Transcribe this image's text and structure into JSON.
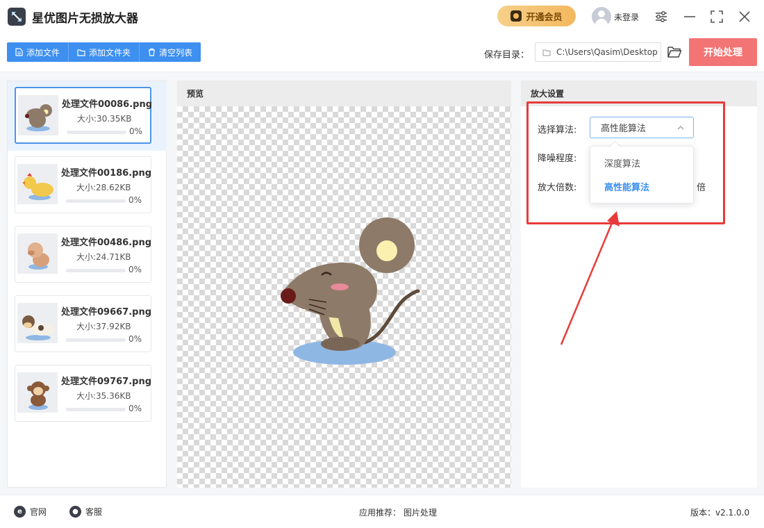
{
  "app": {
    "title": "星优图片无损放大器",
    "vip_label": "开通会员",
    "login_label": "未登录"
  },
  "toolbar": {
    "add_file": "添加文件",
    "add_folder": "添加文件夹",
    "clear_list": "清空列表",
    "save_dir_label": "保存目录：",
    "save_dir_value": "C:\\Users\\Qasim\\Desktop",
    "start_label": "开始处理"
  },
  "files": [
    {
      "name": "处理文件00086.png",
      "size": "大小:30.35KB",
      "progress": 0,
      "pct": "0%",
      "thumb": "mouse"
    },
    {
      "name": "处理文件00186.png",
      "size": "大小:28.62KB",
      "progress": 0,
      "pct": "0%",
      "thumb": "chick"
    },
    {
      "name": "处理文件00486.png",
      "size": "大小:24.71KB",
      "progress": 0,
      "pct": "0%",
      "thumb": "pig"
    },
    {
      "name": "处理文件09667.png",
      "size": "大小:37.92KB",
      "progress": 0,
      "pct": "0%",
      "thumb": "cow"
    },
    {
      "name": "处理文件09767.png",
      "size": "大小:35.36KB",
      "progress": 0,
      "pct": "0%",
      "thumb": "monkey"
    }
  ],
  "preview": {
    "header": "预览"
  },
  "settings": {
    "header": "放大设置",
    "algo_label": "选择算法:",
    "algo_value": "高性能算法",
    "noise_label": "降噪程度:",
    "scale_label": "放大倍数:",
    "scale_unit": "倍",
    "algo_options": [
      "深度算法",
      "高性能算法"
    ],
    "highlight_color": "#e83a3a"
  },
  "footer": {
    "website": "官网",
    "support": "客服",
    "recommend_label": "应用推荐：",
    "recommend_value": "图片处理",
    "version": "版本：v2.1.0.0"
  }
}
